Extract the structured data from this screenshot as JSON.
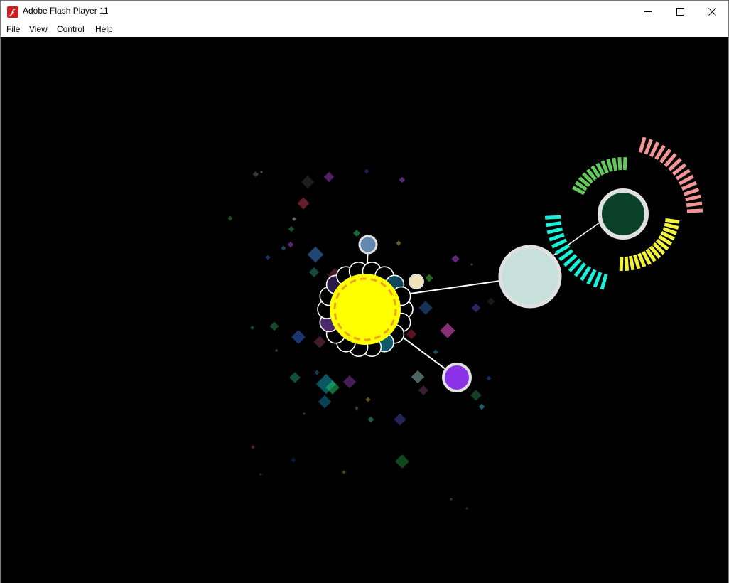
{
  "window": {
    "title": "Adobe Flash Player 11",
    "icon": "flash-player-icon",
    "controls": [
      "minimize-icon",
      "maximize-icon",
      "close-icon"
    ]
  },
  "menu": {
    "file": "File",
    "view": "View",
    "control": "Control",
    "help": "Help"
  },
  "stage": {
    "background": "#000000",
    "colors": {
      "sun": "#ffff00",
      "sun_dash": "#f2a020",
      "planet_blue": "#6388b0",
      "planet_cream": "#f2e2b8",
      "planet_purple": "#8b32e8",
      "planet_pale": "#c8e0da",
      "planet_dark_green": "#0b4128",
      "ring_cyan": "#18f0d8",
      "ring_green": "#62c85a",
      "ring_pink": "#f29494",
      "ring_yellow": "#f2f23a",
      "planet_border": "#e0e0e0"
    }
  }
}
